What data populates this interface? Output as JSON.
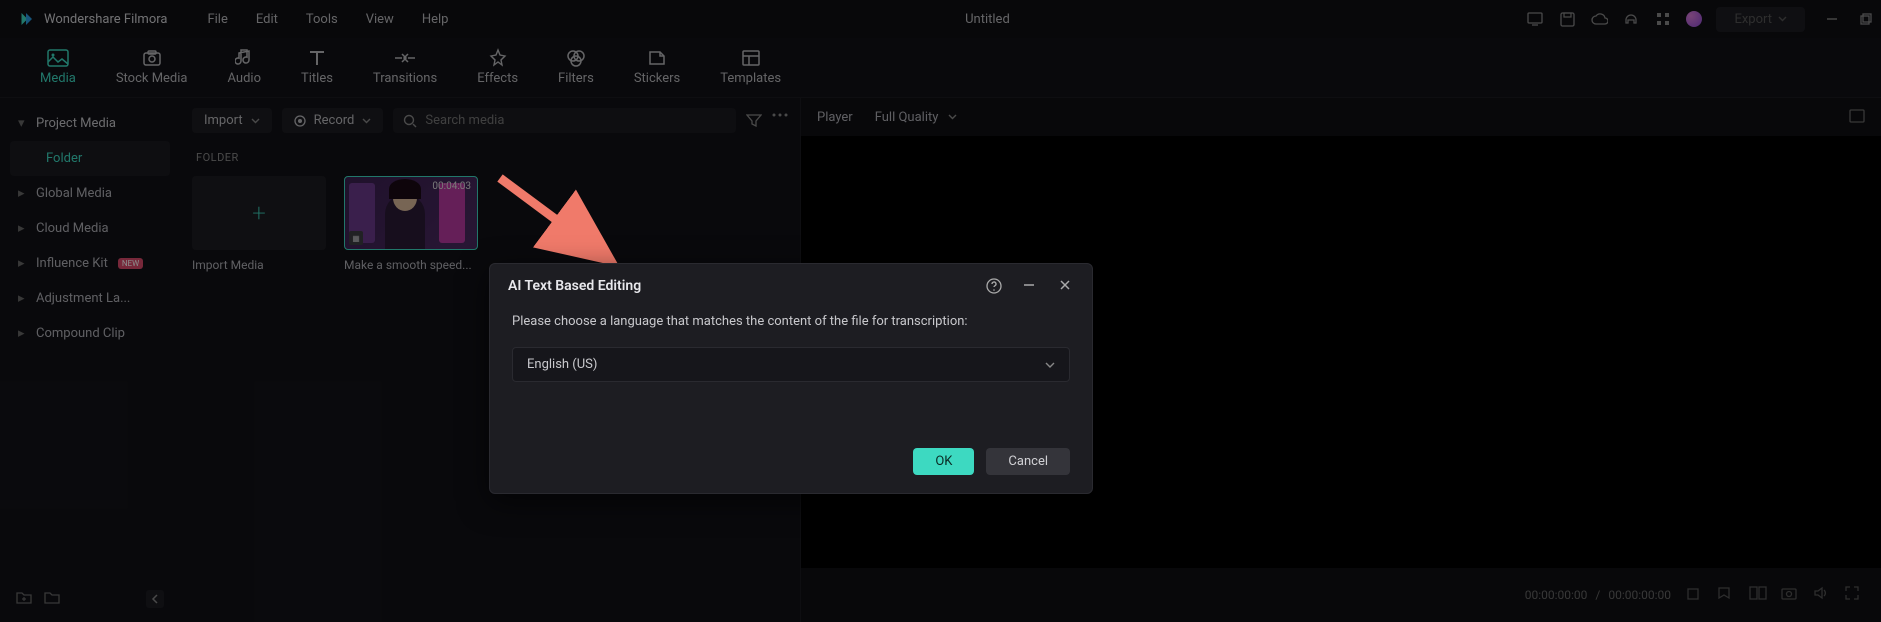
{
  "app": {
    "name": "Wondershare Filmora",
    "title": "Untitled"
  },
  "menubar": {
    "file": "File",
    "edit": "Edit",
    "tools": "Tools",
    "view": "View",
    "help": "Help"
  },
  "titlebar": {
    "export": "Export"
  },
  "toolbar": {
    "media": "Media",
    "stock_media": "Stock Media",
    "audio": "Audio",
    "titles": "Titles",
    "transitions": "Transitions",
    "effects": "Effects",
    "filters": "Filters",
    "stickers": "Stickers",
    "templates": "Templates"
  },
  "sidebar": {
    "project_media": "Project Media",
    "folder": "Folder",
    "global_media": "Global Media",
    "cloud_media": "Cloud Media",
    "influence_kit": "Influence Kit",
    "influence_badge": "NEW",
    "adjustment_layer": "Adjustment La...",
    "compound_clip": "Compound Clip"
  },
  "media_header": {
    "import": "Import",
    "record": "Record",
    "search_placeholder": "Search media"
  },
  "media": {
    "section_label": "FOLDER",
    "import_tile": "Import Media",
    "clip1_label": "Make a smooth speed...",
    "clip1_duration": "00:04:03"
  },
  "preview": {
    "player": "Player",
    "full_quality": "Full Quality",
    "time_current": "00:00:00:00",
    "time_sep": "/",
    "time_total": "00:00:00:00"
  },
  "dialog": {
    "title": "AI Text Based Editing",
    "prompt": "Please choose a language that matches the content of the file for transcription:",
    "selected_language": "English (US)",
    "ok": "OK",
    "cancel": "Cancel"
  }
}
